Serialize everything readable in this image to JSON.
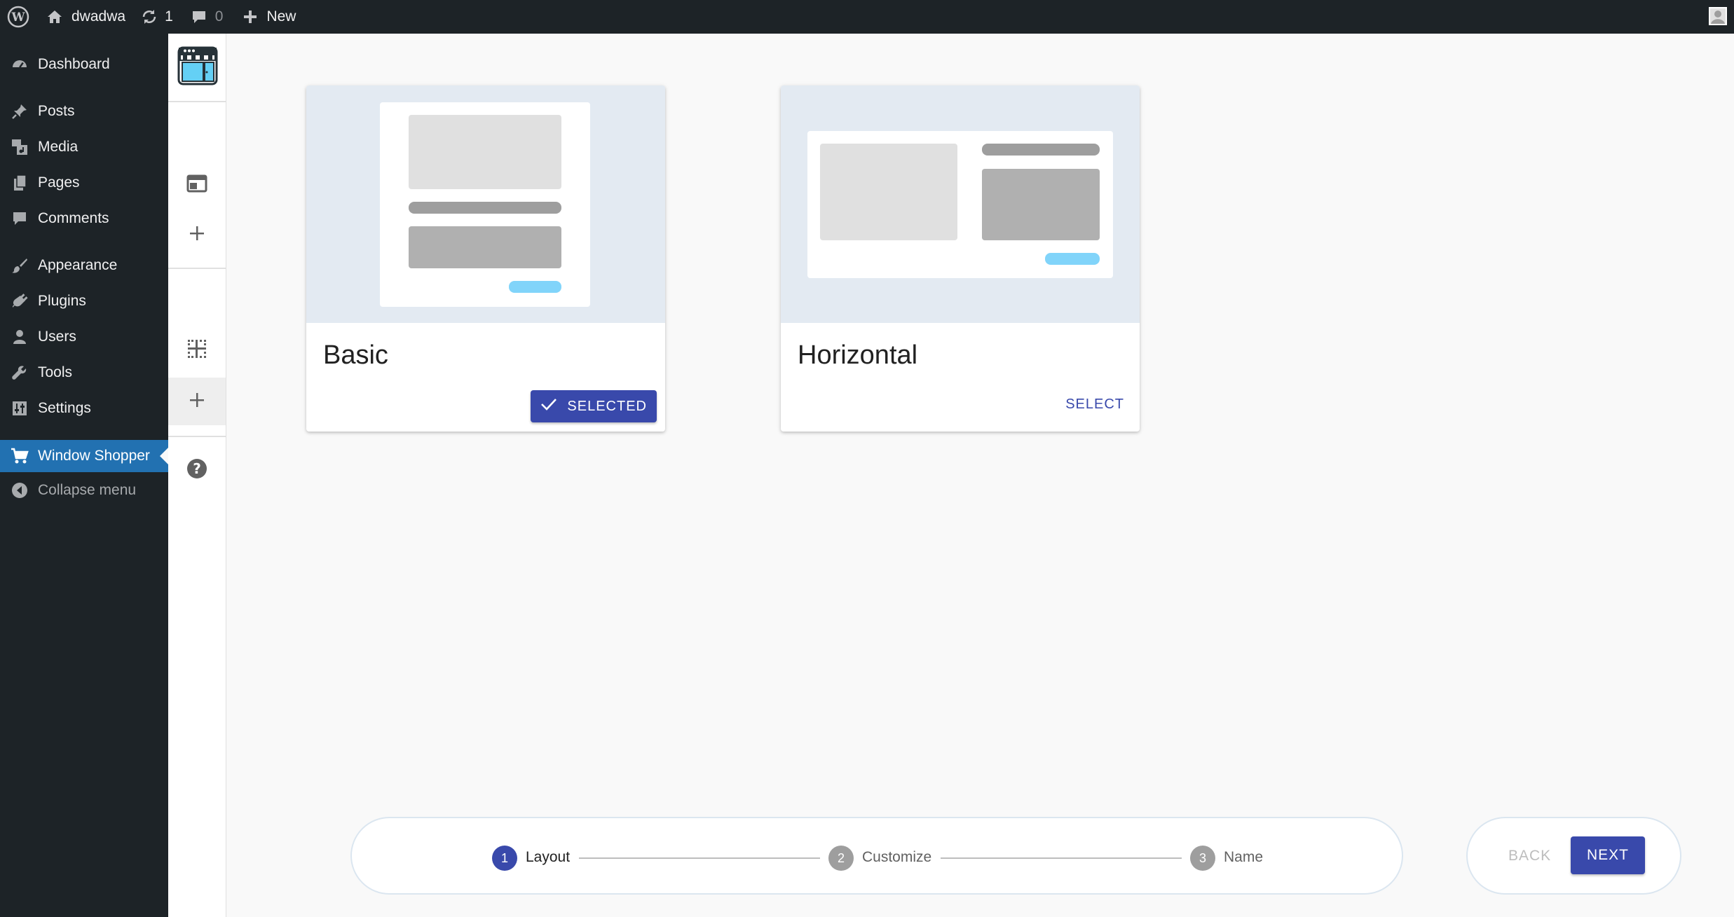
{
  "admin_bar": {
    "site_name": "dwadwa",
    "updates_count": "1",
    "comments_count": "0",
    "new_label": "New"
  },
  "admin_menu": {
    "items": [
      {
        "label": "Dashboard",
        "icon": "dashboard-icon"
      },
      {
        "label": "Posts",
        "icon": "pin-icon"
      },
      {
        "label": "Media",
        "icon": "media-icon"
      },
      {
        "label": "Pages",
        "icon": "pages-icon"
      },
      {
        "label": "Comments",
        "icon": "comment-icon"
      },
      {
        "label": "Appearance",
        "icon": "brush-icon"
      },
      {
        "label": "Plugins",
        "icon": "plug-icon"
      },
      {
        "label": "Users",
        "icon": "user-icon"
      },
      {
        "label": "Tools",
        "icon": "wrench-icon"
      },
      {
        "label": "Settings",
        "icon": "sliders-icon"
      },
      {
        "label": "Window Shopper",
        "icon": "cart-icon"
      },
      {
        "label": "Collapse menu",
        "icon": "collapse-icon"
      }
    ],
    "active_item": "Window Shopper"
  },
  "rail": {
    "icons": [
      "storefront-logo-icon",
      "layout-icon",
      "plus-icon",
      "grid-icon",
      "plus-icon",
      "help-icon"
    ]
  },
  "layouts": [
    {
      "title": "Basic",
      "button": "SELECTED",
      "selected": true
    },
    {
      "title": "Horizontal",
      "button": "SELECT",
      "selected": false
    }
  ],
  "stepper": {
    "steps": [
      {
        "number": "1",
        "label": "Layout",
        "active": true
      },
      {
        "number": "2",
        "label": "Customize",
        "active": false
      },
      {
        "number": "3",
        "label": "Name",
        "active": false
      }
    ]
  },
  "navigation": {
    "back_label": "BACK",
    "next_label": "NEXT"
  },
  "colors": {
    "accent": "#3949ab",
    "wp_admin_bg": "#1d2327",
    "wp_active": "#2271b1"
  }
}
